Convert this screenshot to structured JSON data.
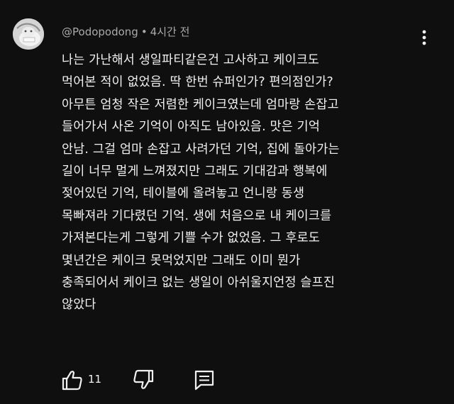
{
  "comment": {
    "author": "@Podopodong",
    "separator": "•",
    "time": "4시간 전",
    "lines": [
      "나는 가난해서 생일파티같은건 고사하고 케이크도",
      "먹어본 적이 없었음. 딱 한번 슈퍼인가? 편의점인가?",
      "아무튼 엄청 작은 저렴한 케이크였는데 엄마랑 손잡고",
      "들어가서 사온 기억이 아직도 남아있음. 맛은 기억",
      "안남. 그걸 엄마 손잡고 사려가던 기억, 집에 돌아가는",
      "길이 너무 멀게 느껴졌지만 그래도 기대감과 행복에",
      "젖어있던 기억, 테이블에 올려놓고 언니랑 동생",
      "목빠져라 기다렸던 기억. 생에 처음으로 내 케이크를",
      "가져본다는게 그렇게 기쁠 수가 없었음. 그 후로도",
      "몇년간은 케이크 못먹었지만 그래도 이미 뭔가",
      "충족되어서 케이크 없는 생일이 아쉬울지언정 슬프진",
      "않았다"
    ],
    "like_count": "11"
  },
  "icons": {
    "menu": "more-vert-icon",
    "like": "thumb-up-icon",
    "dislike": "thumb-down-icon",
    "reply": "comment-icon"
  },
  "colors": {
    "background": "#0f0f0f",
    "text": "#f1f1f1",
    "meta": "#aaaaaa"
  }
}
